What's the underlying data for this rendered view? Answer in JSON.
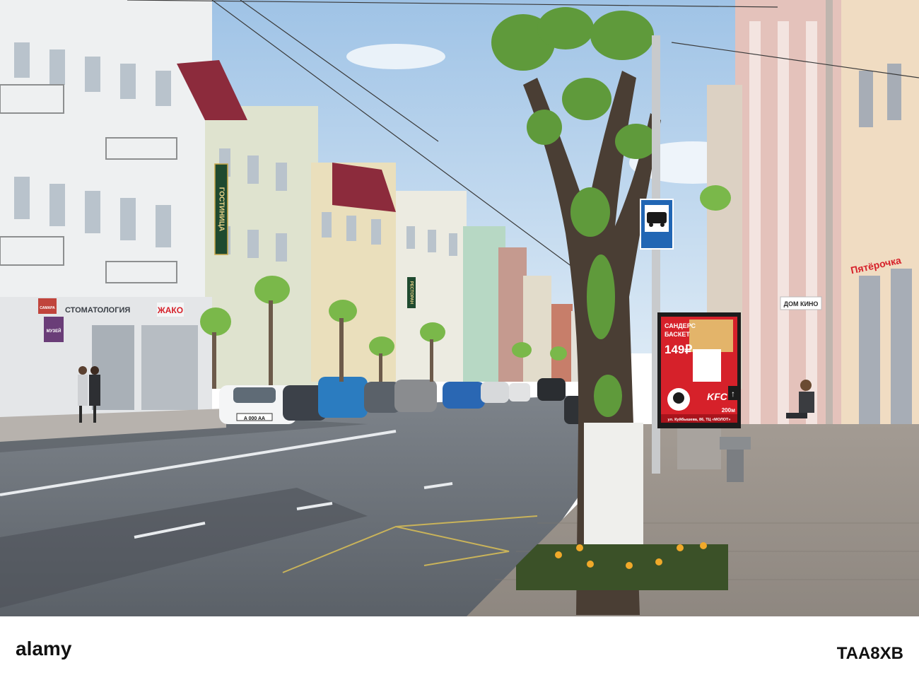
{
  "photo": {
    "signs": {
      "hotel": "ГОСТИНИЦА",
      "restaurant": "РЕСТОРАН",
      "stomatology": "СТОМАТОЛОГИЯ",
      "jako": "ЖАКО",
      "dom_kino": "ДОМ КИНО",
      "samara": "САМАРА",
      "museum": "МУЗЕЙ",
      "pyaterochka": "Пятёрочка"
    },
    "billboard": {
      "headline_1": "САНДЕРС",
      "headline_2": "БАСКЕТ",
      "price": "149₽",
      "brand": "KFC",
      "distance": "200м",
      "address": "ул. Куйбышева, 86, ТЦ «МОЛОТ»"
    },
    "car_plate": "A 000 AA"
  },
  "watermark": {
    "logo_text": "alamy",
    "image_id": "TAA8XB"
  },
  "colors": {
    "sky": "#bcd6ec",
    "kfc_red": "#d6212a",
    "hotel_green": "#1f4a2f",
    "bus_sign_blue": "#2166b4"
  }
}
